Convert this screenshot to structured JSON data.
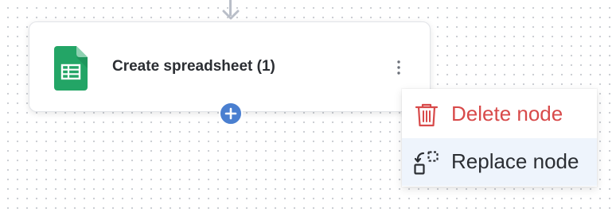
{
  "node": {
    "title": "Create spreadsheet (1)",
    "icon": "google-sheets-icon",
    "more_icon": "kebab-vertical-icon"
  },
  "add_button": {
    "icon": "plus-icon"
  },
  "context_menu": {
    "items": [
      {
        "label": "Delete node",
        "icon": "trash-icon",
        "color": "#d84a4a"
      },
      {
        "label": "Replace node",
        "icon": "replace-icon",
        "color": "#2b2e33"
      }
    ]
  },
  "colors": {
    "accent": "#4a7fd0",
    "sheets_green": "#23a566",
    "danger": "#d84a4a",
    "hover_bg": "#eef4fc",
    "connector": "#b9bec8"
  }
}
